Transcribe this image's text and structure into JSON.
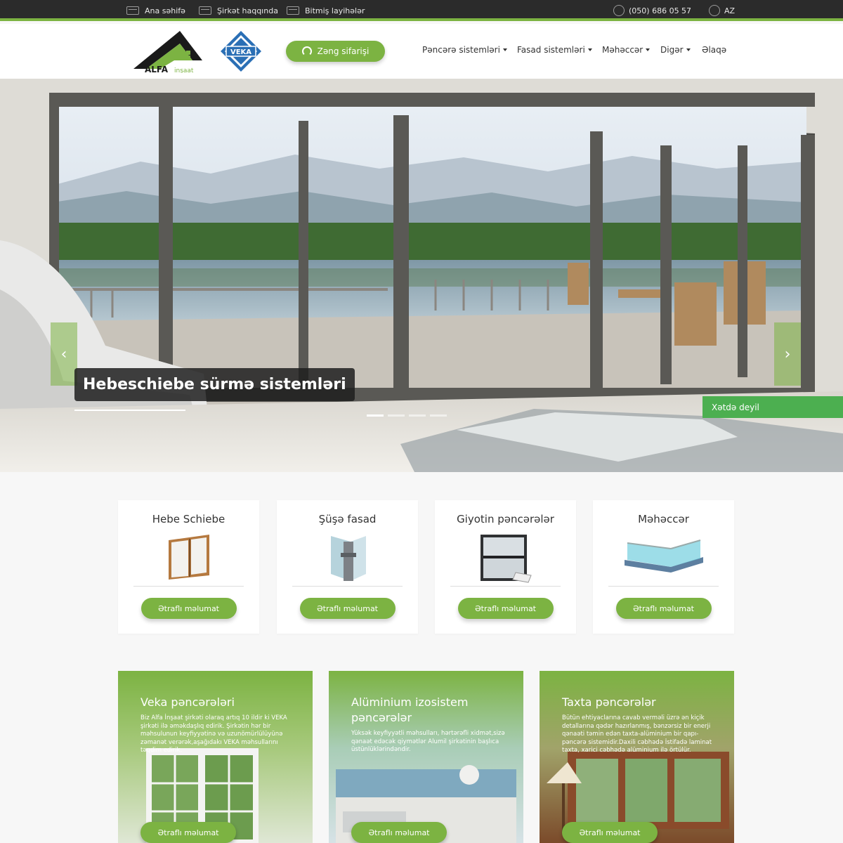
{
  "topbar": {
    "home": "Ana səhifə",
    "about": "Şirkət haqqında",
    "projects": "Bitmiş layihələr",
    "phone": "(050) 686 05 57",
    "lang": "AZ"
  },
  "header": {
    "logo_alfa_text": "ALFA",
    "logo_alfa_sub": "inşaat",
    "logo_veka_text": "VEKA",
    "call_button": "Zəng sifarişi",
    "nav": [
      "Pəncərə sistemləri",
      "Fasad sistemləri",
      "Məhəccər",
      "Digər",
      "Əlaqə"
    ]
  },
  "hero": {
    "title": "Hebeschiebe sürmə sistemləri",
    "prev_arrow": "‹",
    "next_arrow": "›",
    "status": "Xətdə deyil",
    "slides": 4,
    "active_slide": 1
  },
  "products": [
    {
      "title": "Hebe Schiebe",
      "button": "Ətraflı məlumat"
    },
    {
      "title": "Şüşə fasad",
      "button": "Ətraflı məlumat"
    },
    {
      "title": "Giyotin pəncərələr",
      "button": "Ətraflı məlumat"
    },
    {
      "title": "Məhəccər",
      "button": "Ətraflı məlumat"
    }
  ],
  "features": [
    {
      "title": "Veka pəncərələri",
      "desc": "Biz Alfa İnşaat şirkəti olaraq artıq 10 ildir ki VEKA şirkəti ilə əməkdaşlıq edirik. Şirkətin hər bir məhsulunun keyfiyyətinə və uzunömürlülüyünə zəmanət verərək,aşağıdakı VEKA məhsullarını təqdim edirik.",
      "button": "Ətraflı məlumat"
    },
    {
      "title": "Alüminium izosistem pəncərələr",
      "desc": "Yüksək keyfiyyətli məhsulları, hərtərəfli xidmət,sizə qənaət edəcək qiymətlər Alumil şirkətinin başlıca üstünlüklərindəndir.",
      "button": "Ətraflı məlumat"
    },
    {
      "title": "Taxta pəncərələr",
      "desc": "Bütün ehtiyaclarına cavab verməli üzrə ən kiçik detallarına qədər hazırlanmış, bənzərsiz bir enerji qənaəti təmin edən taxta-alüminium bir qapı-pəncərə sistemidir.Daxili cəbhədə İstifadə laminat taxta, xarici cəbhədə alüminium ilə örtülür.",
      "button": "Ətraflı məlumat"
    }
  ],
  "colors": {
    "accent": "#7cb342",
    "topbar": "#2b2b2b",
    "status": "#4caf50"
  }
}
